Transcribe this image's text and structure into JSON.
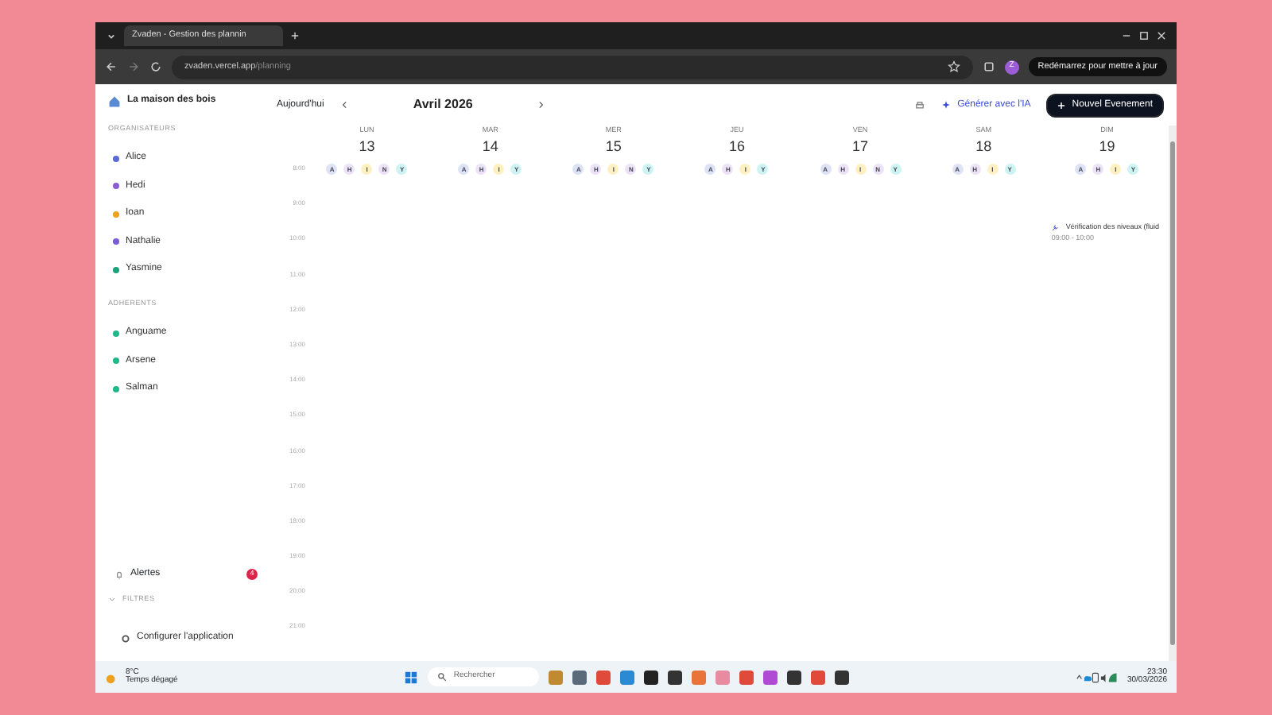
{
  "browser": {
    "tab_title": "Zvaden - Gestion des plannin",
    "url_host": "zvaden.vercel.app",
    "url_path": "/planning",
    "update_button": "Redémarrez pour mettre à jour",
    "profile_initial": "Z"
  },
  "app": {
    "org_name": "La maison des bois",
    "today_button": "Aujourd'hui",
    "month": "Avril 2026",
    "ai_button": "Générer avec l'IA",
    "new_button": "Nouvel Evenement"
  },
  "sidebar": {
    "sections": [
      {
        "title": "ORGANISATEURS",
        "people": [
          {
            "name": "Alice",
            "color": "#5b6bd6"
          },
          {
            "name": "Hedi",
            "color": "#8a5cd6"
          },
          {
            "name": "Ioan",
            "color": "#f0a020"
          },
          {
            "name": "Nathalie",
            "color": "#7a5cd6"
          },
          {
            "name": "Yasmine",
            "color": "#1aa37a"
          }
        ]
      },
      {
        "title": "ADHERENTS",
        "people": [
          {
            "name": "Anguame",
            "color": "#20b888"
          },
          {
            "name": "Arsene",
            "color": "#20b888"
          },
          {
            "name": "Salman",
            "color": "#20b888"
          }
        ]
      }
    ],
    "alerts": {
      "label": "Alertes",
      "count": "4"
    },
    "filters": {
      "label": "FILTRES",
      "expanded": false
    },
    "settings": "Configurer l'application"
  },
  "days": [
    {
      "name": "LUN",
      "date": "13",
      "chips": [
        {
          "letter": "A",
          "color": "#dde3f5"
        },
        {
          "letter": "H",
          "color": "#ece3f7"
        },
        {
          "letter": "I",
          "color": "#fdf1c4"
        },
        {
          "letter": "N",
          "color": "#ece3f7"
        },
        {
          "letter": "Y",
          "color": "#cdf4f2"
        }
      ]
    },
    {
      "name": "MAR",
      "date": "14",
      "chips": [
        {
          "letter": "A",
          "color": "#dde3f5"
        },
        {
          "letter": "H",
          "color": "#ece3f7"
        },
        {
          "letter": "I",
          "color": "#fdf1c4"
        },
        {
          "letter": "Y",
          "color": "#cdf4f2"
        }
      ]
    },
    {
      "name": "MER",
      "date": "15",
      "chips": [
        {
          "letter": "A",
          "color": "#dde3f5"
        },
        {
          "letter": "H",
          "color": "#ece3f7"
        },
        {
          "letter": "I",
          "color": "#fdf1c4"
        },
        {
          "letter": "N",
          "color": "#ece3f7"
        },
        {
          "letter": "Y",
          "color": "#cdf4f2"
        }
      ]
    },
    {
      "name": "JEU",
      "date": "16",
      "chips": [
        {
          "letter": "A",
          "color": "#dde3f5"
        },
        {
          "letter": "H",
          "color": "#ece3f7"
        },
        {
          "letter": "I",
          "color": "#fdf1c4"
        },
        {
          "letter": "Y",
          "color": "#cdf4f2"
        }
      ]
    },
    {
      "name": "VEN",
      "date": "17",
      "chips": [
        {
          "letter": "A",
          "color": "#dde3f5"
        },
        {
          "letter": "H",
          "color": "#ece3f7"
        },
        {
          "letter": "I",
          "color": "#fdf1c4"
        },
        {
          "letter": "N",
          "color": "#ece3f7"
        },
        {
          "letter": "Y",
          "color": "#cdf4f2"
        }
      ]
    },
    {
      "name": "SAM",
      "date": "18",
      "chips": [
        {
          "letter": "A",
          "color": "#dde3f5"
        },
        {
          "letter": "H",
          "color": "#ece3f7"
        },
        {
          "letter": "I",
          "color": "#fdf1c4"
        },
        {
          "letter": "Y",
          "color": "#cdf4f2"
        }
      ]
    },
    {
      "name": "DIM",
      "date": "19",
      "chips": [
        {
          "letter": "A",
          "color": "#dde3f5"
        },
        {
          "letter": "H",
          "color": "#ece3f7"
        },
        {
          "letter": "I",
          "color": "#fdf1c4"
        },
        {
          "letter": "Y",
          "color": "#cdf4f2"
        }
      ],
      "events": [
        {
          "title": "Vérification des niveaux (fluid",
          "time": "09:00 - 10:00"
        }
      ]
    }
  ],
  "hours": [
    "8:00",
    "9:00",
    "10:00",
    "11:00",
    "12:00",
    "13:00",
    "14:00",
    "15:00",
    "16:00",
    "17:00",
    "18:00",
    "19:00",
    "20:00",
    "21:00"
  ],
  "taskbar": {
    "weather_temp": "8°C",
    "weather_text": "Temps dégagé",
    "search_placeholder": "Rechercher",
    "apps": [
      {
        "color": "#c08a30"
      },
      {
        "color": "#5a6a7a"
      },
      {
        "color": "#e04a3a"
      },
      {
        "color": "#2a8ad4"
      },
      {
        "color": "#222222"
      },
      {
        "color": "#333333"
      },
      {
        "color": "#e8743a"
      },
      {
        "color": "#e88aa0"
      },
      {
        "color": "#e04a3a"
      },
      {
        "color": "#b04ad4"
      },
      {
        "color": "#333333"
      },
      {
        "color": "#e04a3a"
      },
      {
        "color": "#333333"
      }
    ],
    "time": "23:30",
    "date": "30/03/2026"
  }
}
